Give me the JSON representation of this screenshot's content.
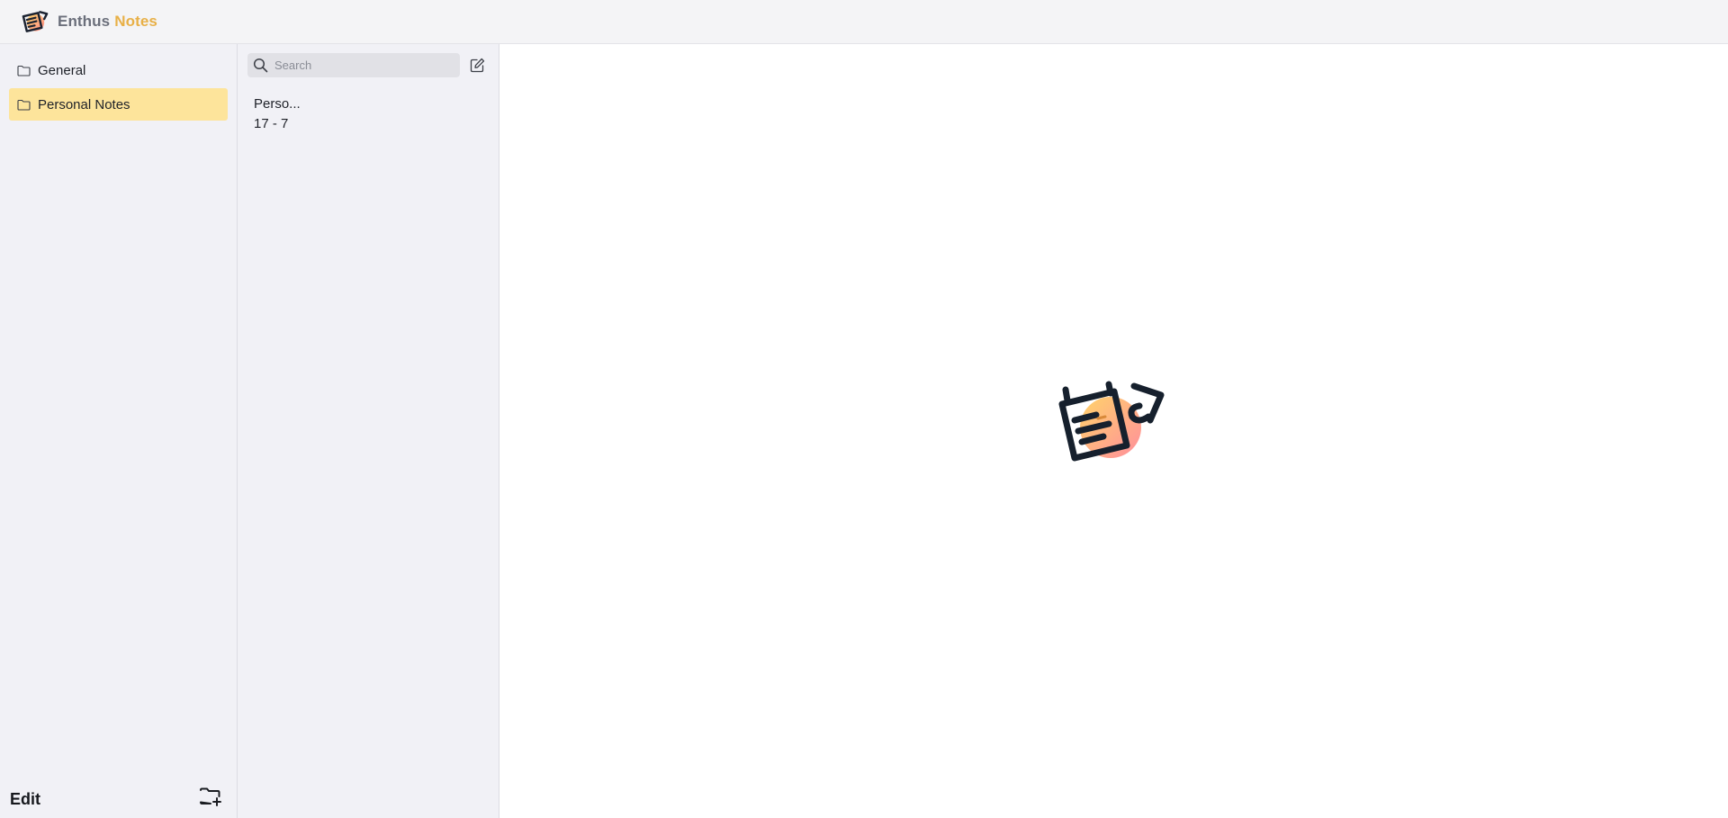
{
  "app": {
    "title_primary": "Enthus",
    "title_accent": "Notes",
    "logo_icon": "notes-logo-icon",
    "accent_color": "#e8b047",
    "selected_color": "#fde49b"
  },
  "sidebar": {
    "folders": [
      {
        "label": "General",
        "icon": "folder-icon",
        "selected": false
      },
      {
        "label": "Personal Notes",
        "icon": "folder-icon",
        "selected": true
      }
    ],
    "edit_label": "Edit",
    "new_folder_icon": "folder-plus-icon"
  },
  "notes_panel": {
    "search": {
      "placeholder": "Search",
      "value": ""
    },
    "compose_icon": "compose-icon",
    "notes": [
      {
        "title": "Perso...",
        "date": "17 - 7"
      }
    ]
  },
  "main": {
    "empty_state_icon": "notes-illustration-icon"
  }
}
